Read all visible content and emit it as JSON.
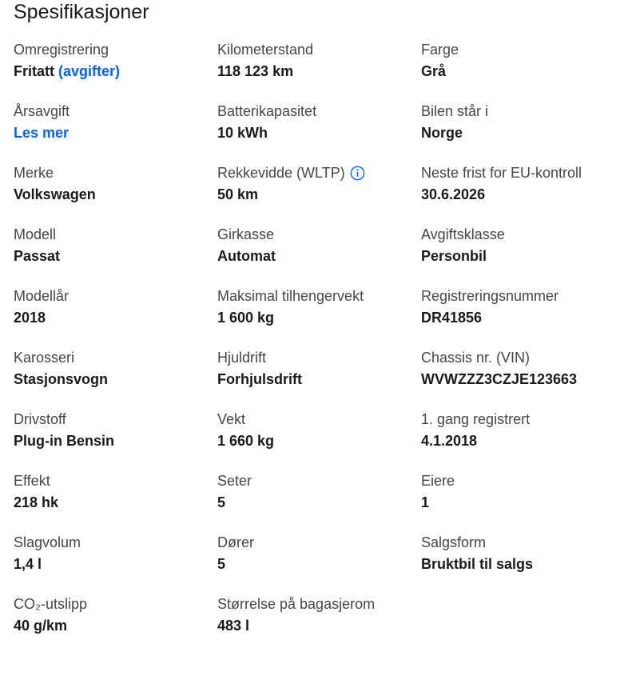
{
  "title": "Spesifikasjoner",
  "specs": [
    {
      "label": "Omregistrering",
      "value": "Fritatt",
      "link": "(avgifter)"
    },
    {
      "label": "Kilometerstand",
      "value": "118 123 km"
    },
    {
      "label": "Farge",
      "value": "Grå"
    },
    {
      "label": "Årsavgift",
      "link_value": "Les mer"
    },
    {
      "label": "Batterikapasitet",
      "value": "10 kWh"
    },
    {
      "label": "Bilen står i",
      "value": "Norge"
    },
    {
      "label": "Merke",
      "value": "Volkswagen"
    },
    {
      "label": "Rekkevidde (WLTP)",
      "value": "50 km",
      "icon": "info-icon"
    },
    {
      "label": "Neste frist for EU-kontroll",
      "value": "30.6.2026"
    },
    {
      "label": "Modell",
      "value": "Passat"
    },
    {
      "label": "Girkasse",
      "value": "Automat"
    },
    {
      "label": "Avgiftsklasse",
      "value": "Personbil"
    },
    {
      "label": "Modellår",
      "value": "2018"
    },
    {
      "label": "Maksimal tilhengervekt",
      "value": "1 600 kg"
    },
    {
      "label": "Registreringsnummer",
      "value": "DR41856"
    },
    {
      "label": "Karosseri",
      "value": "Stasjonsvogn"
    },
    {
      "label": "Hjuldrift",
      "value": "Forhjulsdrift"
    },
    {
      "label": "Chassis nr. (VIN)",
      "value": "WVWZZZ3CZJE123663"
    },
    {
      "label": "Drivstoff",
      "value": "Plug-in Bensin"
    },
    {
      "label": "Vekt",
      "value": "1 660 kg"
    },
    {
      "label": "1. gang registrert",
      "value": "4.1.2018"
    },
    {
      "label": "Effekt",
      "value": "218 hk"
    },
    {
      "label": "Seter",
      "value": "5"
    },
    {
      "label": "Eiere",
      "value": "1"
    },
    {
      "label": "Slagvolum",
      "value": "1,4 l"
    },
    {
      "label": "Dører",
      "value": "5"
    },
    {
      "label": "Salgsform",
      "value": "Bruktbil til salgs"
    },
    {
      "label": "CO₂-utslipp",
      "value": "40 g/km"
    },
    {
      "label": "Størrelse på bagasjerom",
      "value": "483 l"
    }
  ],
  "colors": {
    "link": "#0063fb",
    "label": "#464646",
    "value": "#1a1a1a"
  }
}
